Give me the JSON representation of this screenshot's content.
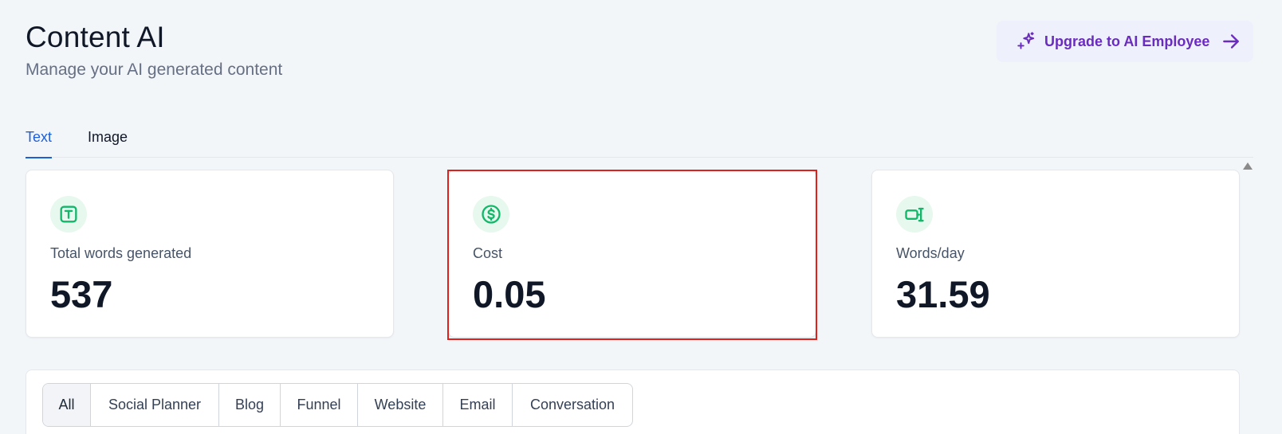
{
  "header": {
    "title": "Content AI",
    "subtitle": "Manage your AI generated content"
  },
  "upgrade": {
    "label": "Upgrade to AI Employee"
  },
  "tabs": [
    {
      "label": "Text",
      "active": true
    },
    {
      "label": "Image",
      "active": false
    }
  ],
  "stats": [
    {
      "label": "Total words generated",
      "value": "537",
      "icon": "text-box-icon"
    },
    {
      "label": "Cost",
      "value": "0.05",
      "icon": "dollar-circle-icon"
    },
    {
      "label": "Words/day",
      "value": "31.59",
      "icon": "words-per-day-icon"
    }
  ],
  "filters": [
    {
      "label": "All",
      "active": true
    },
    {
      "label": "Social Planner",
      "active": false
    },
    {
      "label": "Blog",
      "active": false
    },
    {
      "label": "Funnel",
      "active": false
    },
    {
      "label": "Website",
      "active": false
    },
    {
      "label": "Email",
      "active": false
    },
    {
      "label": "Conversation",
      "active": false
    }
  ],
  "colors": {
    "accent_blue": "#1f5fd6",
    "upgrade_purple": "#6a2bbf",
    "icon_green": "#12b76a",
    "highlight_red": "#e0211b"
  }
}
